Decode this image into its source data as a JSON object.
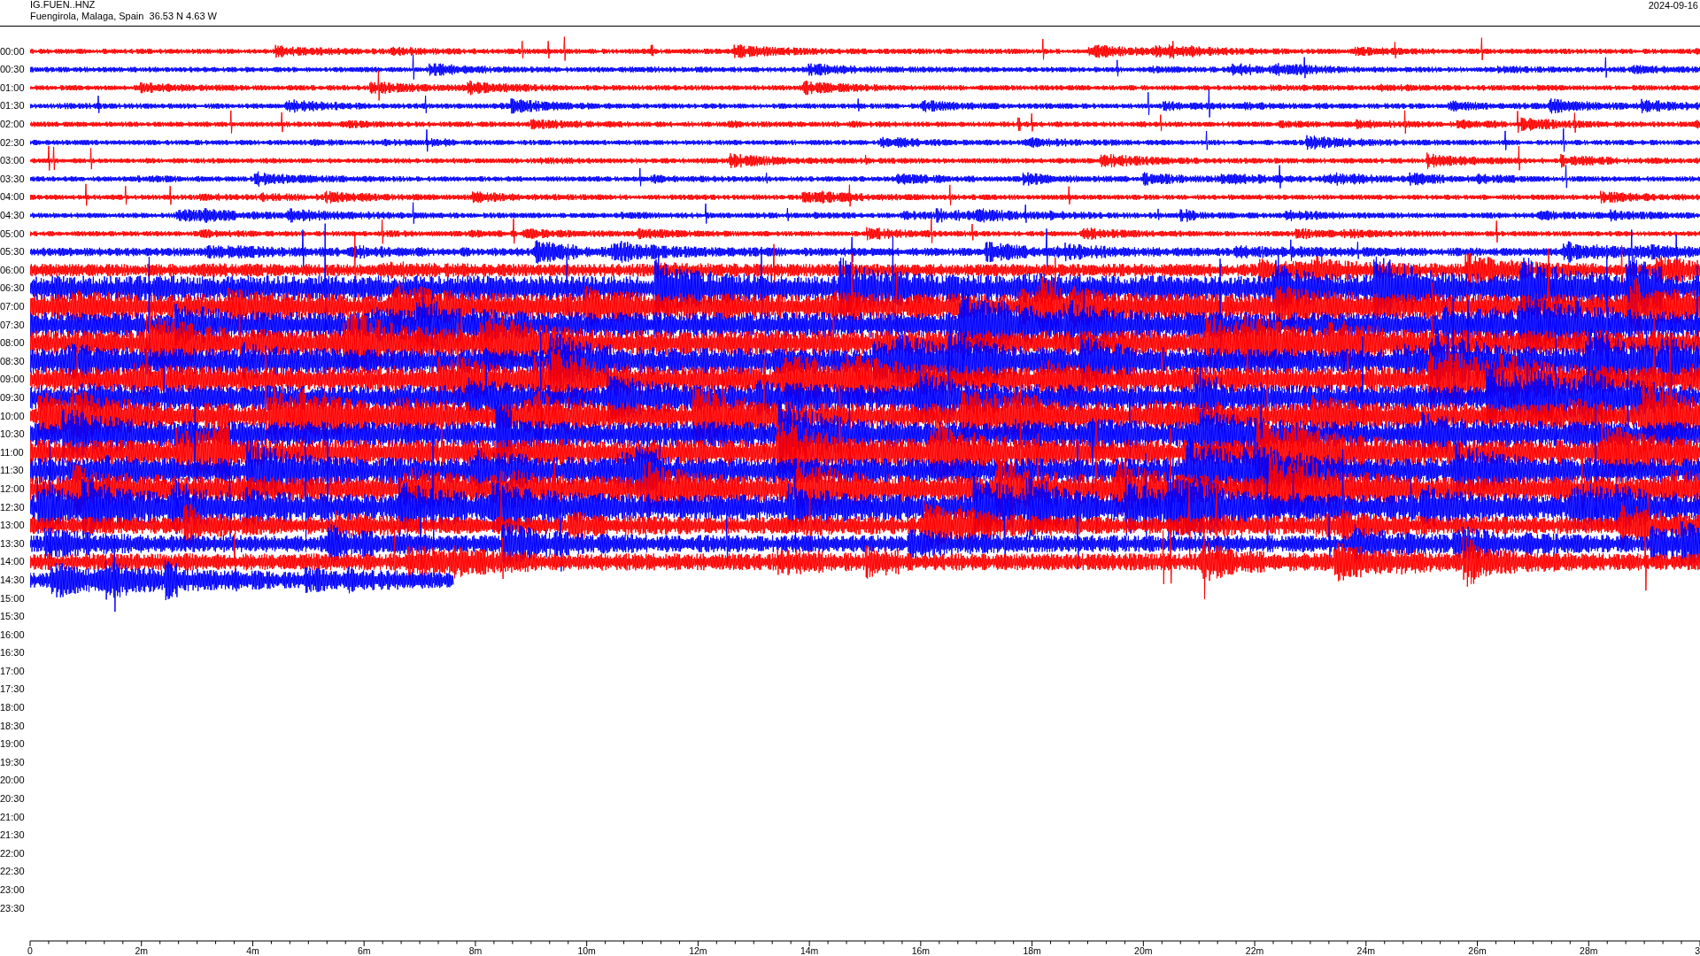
{
  "header": {
    "station": "IG.FUEN..HNZ",
    "location": "Fuengirola, Malaga, Spain  36.53 N 4.63 W",
    "date": "2024-09-16"
  },
  "helicorder": {
    "rows": [
      {
        "time": "00:00",
        "trace": {
          "color": "#ff0000"
        }
      },
      {
        "time": "00:30",
        "trace": {
          "color": "#0000ff"
        }
      },
      {
        "time": "01:00",
        "trace": {
          "color": "#ff0000"
        }
      },
      {
        "time": "01:30",
        "trace": {
          "color": "#0000ff"
        }
      },
      {
        "time": "02:00",
        "trace": {
          "color": "#ff0000"
        }
      },
      {
        "time": "02:30",
        "trace": {
          "color": "#0000ff"
        }
      },
      {
        "time": "03:00",
        "trace": {
          "color": "#ff0000"
        }
      },
      {
        "time": "03:30",
        "trace": {
          "color": "#0000ff"
        }
      },
      {
        "time": "04:00",
        "trace": {
          "color": "#ff0000"
        }
      },
      {
        "time": "04:30",
        "trace": {
          "color": "#0000ff"
        }
      },
      {
        "time": "05:00",
        "trace": {
          "color": "#ff0000"
        }
      },
      {
        "time": "05:30",
        "trace": {
          "color": "#0000ff"
        }
      },
      {
        "time": "06:00",
        "trace": {
          "color": "#ff0000"
        }
      },
      {
        "time": "06:30",
        "trace": {
          "color": "#0000ff"
        }
      },
      {
        "time": "07:00",
        "trace": {
          "color": "#ff0000"
        }
      },
      {
        "time": "07:30",
        "trace": {
          "color": "#0000ff"
        }
      },
      {
        "time": "08:00",
        "trace": {
          "color": "#ff0000"
        }
      },
      {
        "time": "08:30",
        "trace": {
          "color": "#0000ff"
        }
      },
      {
        "time": "09:00",
        "trace": {
          "color": "#ff0000"
        }
      },
      {
        "time": "09:30",
        "trace": {
          "color": "#0000ff"
        }
      },
      {
        "time": "10:00",
        "trace": {
          "color": "#ff0000"
        }
      },
      {
        "time": "10:30",
        "trace": {
          "color": "#0000ff"
        }
      },
      {
        "time": "11:00",
        "trace": {
          "color": "#ff0000"
        }
      },
      {
        "time": "11:30",
        "trace": {
          "color": "#0000ff"
        }
      },
      {
        "time": "12:00",
        "trace": {
          "color": "#ff0000"
        }
      },
      {
        "time": "12:30",
        "trace": {
          "color": "#0000ff"
        }
      },
      {
        "time": "13:00",
        "trace": {
          "color": "#ff0000"
        }
      },
      {
        "time": "13:30",
        "trace": {
          "color": "#0000ff"
        }
      },
      {
        "time": "14:00",
        "trace": {
          "color": "#ff0000"
        }
      },
      {
        "time": "14:30",
        "trace": {
          "color": "#0000ff"
        }
      },
      {
        "time": "15:00"
      },
      {
        "time": "15:30"
      },
      {
        "time": "16:00"
      },
      {
        "time": "16:30"
      },
      {
        "time": "17:00"
      },
      {
        "time": "17:30"
      },
      {
        "time": "18:00"
      },
      {
        "time": "18:30"
      },
      {
        "time": "19:00"
      },
      {
        "time": "19:30"
      },
      {
        "time": "20:00"
      },
      {
        "time": "20:30"
      },
      {
        "time": "21:00"
      },
      {
        "time": "21:30"
      },
      {
        "time": "22:00"
      },
      {
        "time": "22:30"
      },
      {
        "time": "23:00"
      },
      {
        "time": "23:30"
      }
    ],
    "x_axis": {
      "ticks": [
        "0",
        "2m",
        "4m",
        "6m",
        "8m",
        "10m",
        "12m",
        "14m",
        "16m",
        "18m",
        "20m",
        "22m",
        "24m",
        "26m",
        "28m",
        "3"
      ]
    }
  }
}
